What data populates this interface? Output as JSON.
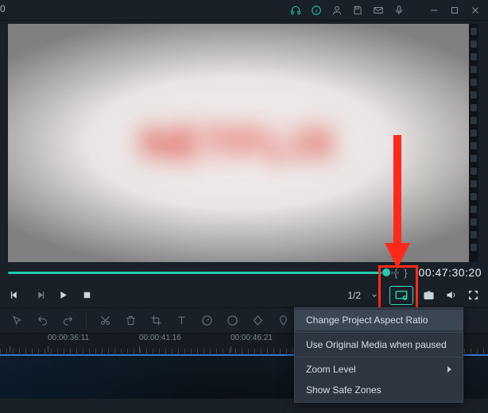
{
  "titlebar": {
    "left_fragment": "0"
  },
  "preview": {
    "blurred_text": "NETFLIX"
  },
  "scrubber": {
    "marker_left": "{",
    "marker_right": "}",
    "timecode": "00:47:30:20"
  },
  "transport": {
    "zoom_level": "1/2"
  },
  "context_menu": {
    "items": [
      {
        "label": "Change Project Aspect Ratio",
        "hover": true,
        "submenu": false
      },
      {
        "label": "Use Original Media when paused",
        "hover": false,
        "submenu": false
      },
      {
        "label": "Zoom Level",
        "hover": false,
        "submenu": true
      },
      {
        "label": "Show Safe Zones",
        "hover": false,
        "submenu": false
      }
    ]
  },
  "timeline": {
    "labels": [
      {
        "text": "",
        "pos": 12
      },
      {
        "text": "00:00:36:11",
        "pos": 60
      },
      {
        "text": "00:00:41:16",
        "pos": 175
      },
      {
        "text": "00:00:46:21",
        "pos": 290
      }
    ]
  }
}
